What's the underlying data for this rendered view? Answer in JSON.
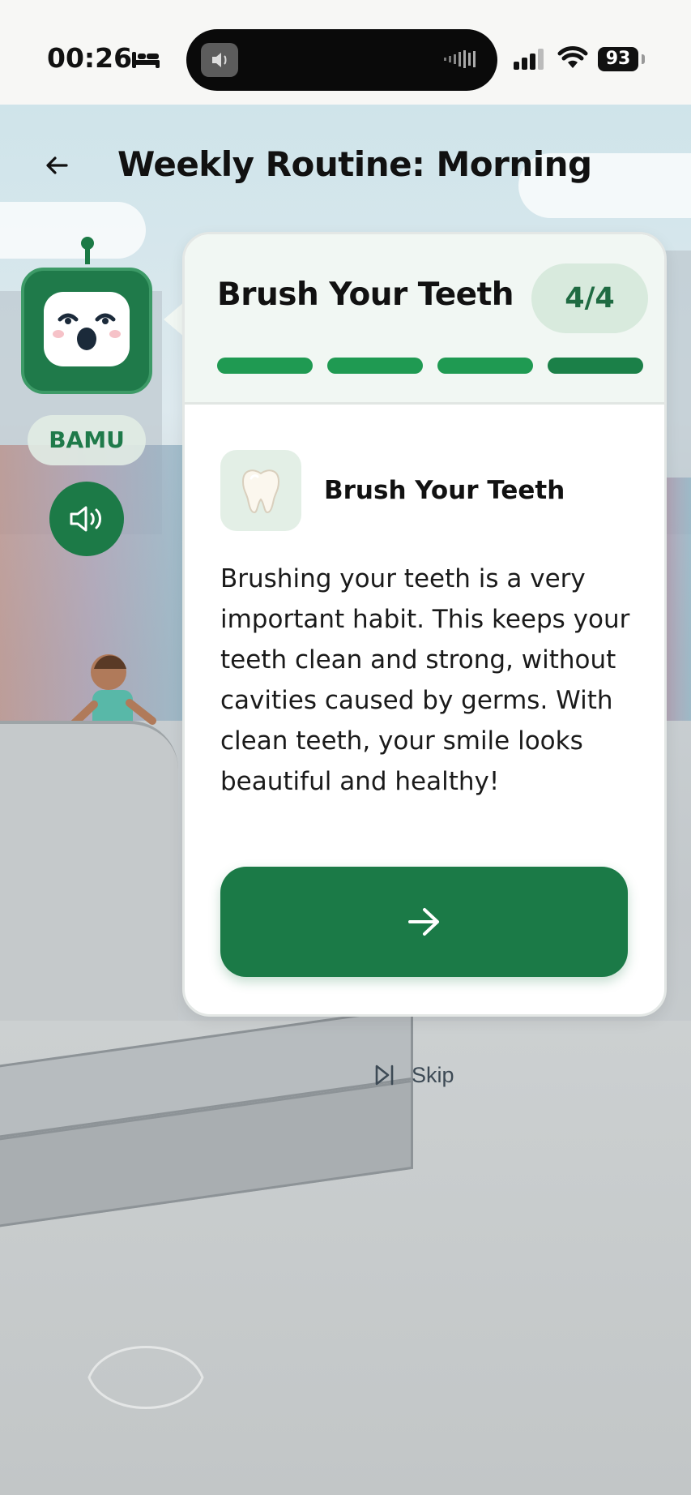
{
  "status_bar": {
    "time": "00:26",
    "battery": "93",
    "icons": [
      "bed-icon",
      "sound-icon",
      "signal-icon",
      "wifi-icon",
      "battery-icon"
    ]
  },
  "header": {
    "title": "Weekly Routine: Morning",
    "back_icon": "arrow-left-icon"
  },
  "mascot": {
    "name": "BAMU",
    "speaker_icon": "speaker-icon"
  },
  "card": {
    "title": "Brush Your Teeth",
    "step": "4/4",
    "progress": {
      "completed": 4,
      "total": 4
    },
    "task": {
      "icon": "tooth-icon",
      "title": "Brush Your Teeth",
      "description": "Brushing your teeth is a very important habit. This keeps your teeth clean and strong, without cavities caused by germs. With clean teeth, your smile looks beautiful and healthy!"
    },
    "next_icon": "arrow-right-icon"
  },
  "skip": {
    "label": "Skip",
    "icon": "skip-forward-icon"
  },
  "colors": {
    "primary_green": "#1b7a47",
    "progress_green": "#1f9a52",
    "badge_bg": "#d8eadd",
    "header_bg": "#f1f7f3"
  }
}
